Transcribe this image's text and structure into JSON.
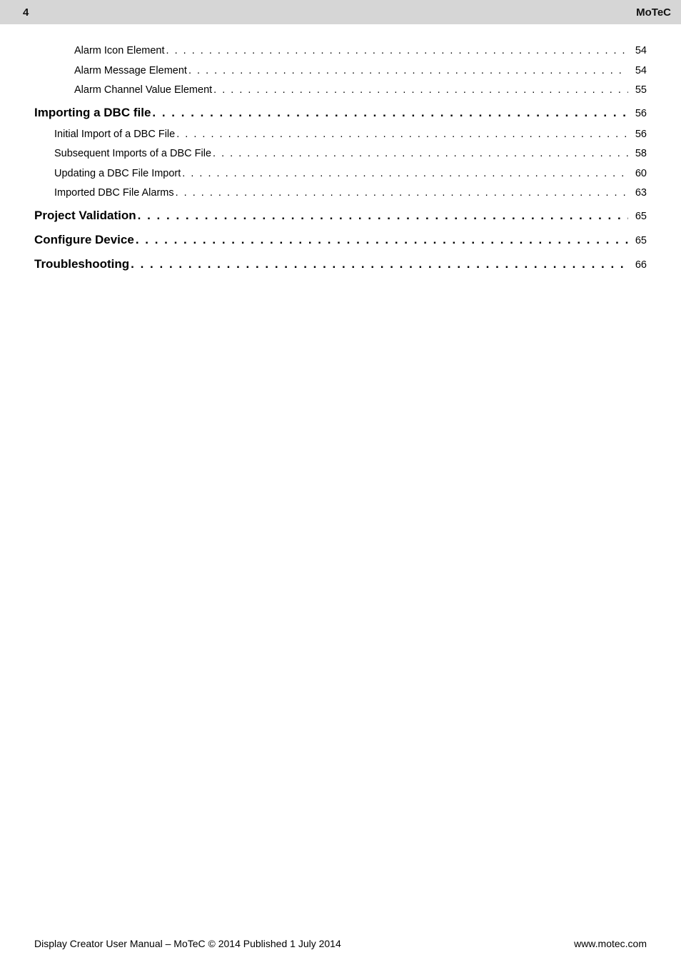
{
  "header": {
    "page_number": "4",
    "brand": "MoTeC"
  },
  "toc": [
    {
      "level": 3,
      "text": "Alarm Icon Element",
      "page": "54"
    },
    {
      "level": 3,
      "text": "Alarm Message Element",
      "page": "54"
    },
    {
      "level": 3,
      "text": "Alarm Channel Value Element",
      "page": "55"
    },
    {
      "level": 1,
      "text": "Importing a DBC file",
      "page": "56"
    },
    {
      "level": 2,
      "text": "Initial Import of a DBC File",
      "page": "56"
    },
    {
      "level": 2,
      "text": "Subsequent Imports of a DBC File",
      "page": "58"
    },
    {
      "level": 2,
      "text": "Updating a DBC File Import",
      "page": "60"
    },
    {
      "level": 2,
      "text": "Imported DBC File Alarms",
      "page": "63"
    },
    {
      "level": 1,
      "text": "Project Validation",
      "page": "65"
    },
    {
      "level": 1,
      "text": "Configure Device",
      "page": "65"
    },
    {
      "level": 1,
      "text": "Troubleshooting",
      "page": "66"
    }
  ],
  "footer": {
    "left": "Display Creator User Manual – MoTeC © 2014 Published 1 July 2014",
    "right": "www.motec.com"
  }
}
